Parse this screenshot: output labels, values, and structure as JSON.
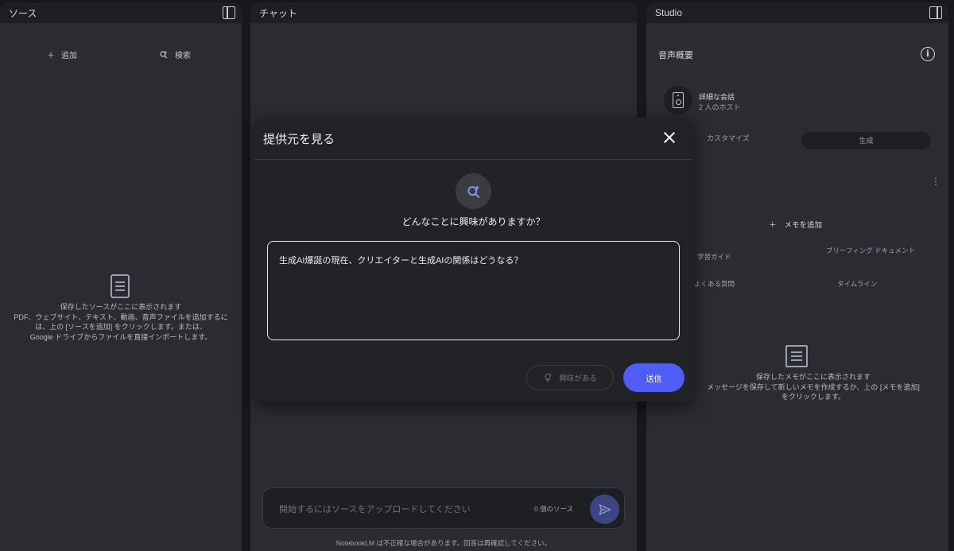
{
  "sources": {
    "title": "ソース",
    "add_label": "追加",
    "search_label": "検索",
    "empty_line1": "保存したソースがここに表示されます",
    "empty_line2": "PDF、ウェブサイト、テキスト、動画、音声ファイルを追加するには、上の [ソースを追加] をクリックします。または、",
    "empty_line3": "Google ドライブからファイルを直接インポートします。"
  },
  "chat": {
    "title": "チャット",
    "input_placeholder": "開始するにはソースをアップロードしてください",
    "source_count": "0 個のソース",
    "disclaimer": "NotebookLM は不正確な場合があります。回答は再確認してください。"
  },
  "studio": {
    "title": "Studio",
    "audio_overview_title": "音声概要",
    "audio_card_title": "詳細な会話",
    "audio_card_subtitle": "2 人のホスト",
    "customize_label": "カスタマイズ",
    "generate_label": "生成",
    "add_memo_label": "メモを追加",
    "study_guide": "学習ガイド",
    "briefing": "ブリーフィング ドキュメント",
    "faq": "よくある質問",
    "timeline": "タイムライン",
    "memo_empty_line1": "保存したメモがここに表示されます",
    "memo_empty_line2": "メッセージを保存して新しいメモを作成するか、上の [メモを追加]",
    "memo_empty_line3": "をクリックします。"
  },
  "modal": {
    "title": "提供元を見る",
    "question": "どんなことに興味がありますか？",
    "textarea_value": "生成AI爆誕の現在、クリエイターと生成AIの関係はどうなる？",
    "interest_label": "興味がある",
    "submit_label": "送信"
  },
  "colors": {
    "accent": "#4f5cf8",
    "panel_bg": "#2a2c31",
    "modal_bg": "#212327"
  }
}
